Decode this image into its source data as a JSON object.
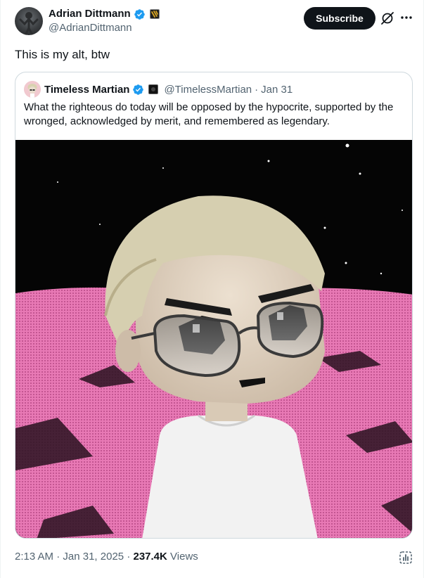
{
  "author": {
    "name": "Adrian Dittmann",
    "handle": "@AdrianDittmann"
  },
  "actions": {
    "subscribe_label": "Subscribe"
  },
  "tweet": {
    "text": "This is my alt, btw",
    "time": "2:13 AM",
    "sep1": "·",
    "date": "Jan 31, 2025",
    "sep2": "·",
    "views_count": "237.4K",
    "views_label": "Views"
  },
  "quote": {
    "name": "Timeless Martian",
    "handle": "@TimelessMartian",
    "sep": "·",
    "date": "Jan 31",
    "text": "What the righteous do today will be opposed by the hypocrite, supported by the wronged, acknowledged by merit, and remembered as legendary."
  },
  "icons": {
    "verified": "verified-badge-icon",
    "affiliate": "affiliate-badge-icon",
    "grok": "grok-icon",
    "more": "more-icon",
    "stats": "post-analytics-icon"
  },
  "colors": {
    "verified_blue": "#1d9bf0",
    "subscribe_bg": "#0f1419",
    "secondary_text": "#536471",
    "border": "#cfd9de",
    "mars_pink": "#e06aa8"
  }
}
